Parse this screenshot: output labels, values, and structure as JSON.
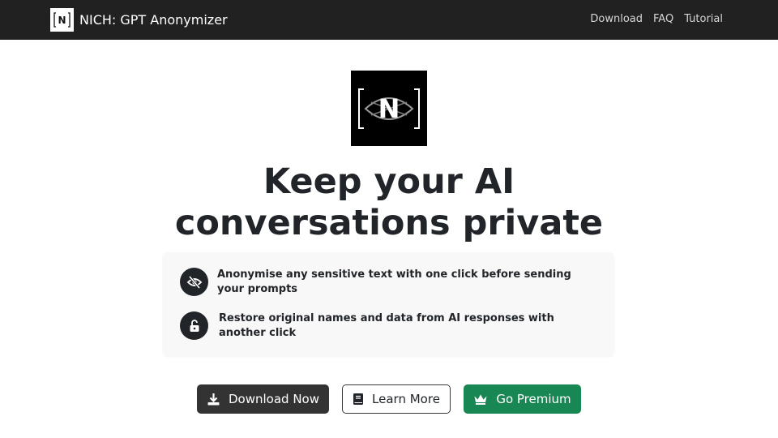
{
  "navbar": {
    "brand_logo_text": "[N]",
    "brand_name": "NICH: GPT Anonymizer",
    "links": [
      "Download",
      "FAQ",
      "Tutorial"
    ]
  },
  "hero": {
    "logo_text": "[N]",
    "headline_line1": "Keep your AI",
    "headline_line2": "conversations private"
  },
  "features": [
    {
      "icon": "eye-slash-icon",
      "text": "Anonymise any sensitive text with one click before sending your prompts"
    },
    {
      "icon": "unlock-icon",
      "text": "Restore original names and data from AI responses with another click"
    }
  ],
  "buttons": {
    "download": "Download Now",
    "learn": "Learn More",
    "premium": "Go Premium"
  },
  "colors": {
    "navbar_bg": "#212121",
    "download_bg": "#333333",
    "premium_bg": "#198754"
  }
}
